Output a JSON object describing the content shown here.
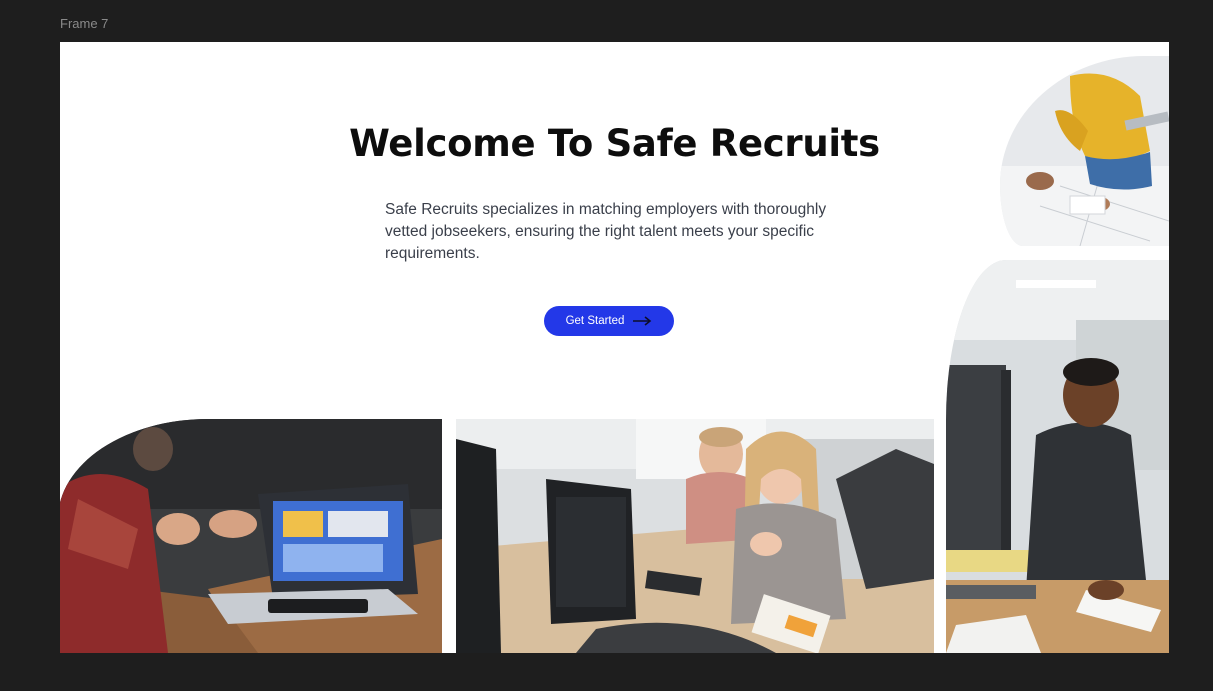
{
  "canvas": {
    "frame_label": "Frame 7"
  },
  "hero": {
    "title": "Welcome To Safe Recruits",
    "description": "Safe Recruits specializes in matching employers with thoroughly vetted jobseekers, ensuring the right talent meets your specific requirements.",
    "cta_label": "Get Started",
    "cta_icon": "arrow-right-icon"
  },
  "colors": {
    "canvas_background": "#1e1e1e",
    "frame_background": "#ffffff",
    "accent": "#2338e8",
    "title": "#0d0d0d",
    "body_text": "#3a3f4a"
  },
  "photos": [
    {
      "name": "photo-team-planning",
      "description": "person in yellow sweater holding tablet over documents"
    },
    {
      "name": "photo-man-writing",
      "description": "young man in black t-shirt writing at office desk"
    },
    {
      "name": "photo-meeting-laptop",
      "description": "hands gesturing in meeting next to laptop"
    },
    {
      "name": "photo-colleagues-monitors",
      "description": "two colleagues looking at computer monitor in office"
    }
  ]
}
